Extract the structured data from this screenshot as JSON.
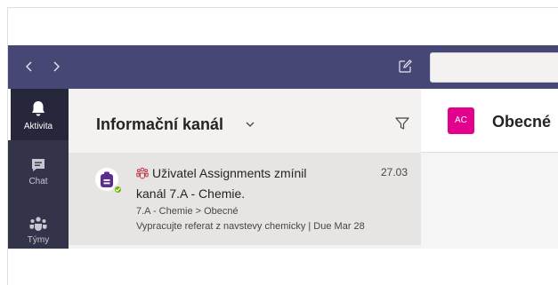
{
  "window": {
    "back_icon": "chevron-left-icon",
    "forward_icon": "chevron-right-icon",
    "compose_icon": "compose-icon",
    "topbar_color": "#464775"
  },
  "rail": {
    "items": [
      {
        "label": "Aktivita",
        "icon": "bell-icon",
        "active": true
      },
      {
        "label": "Chat",
        "icon": "chat-icon",
        "active": false
      },
      {
        "label": "Týmy",
        "icon": "teams-icon",
        "active": false
      }
    ]
  },
  "feed": {
    "title": "Informační kanál",
    "items": [
      {
        "line1": "Uživatel Assignments zmínil",
        "line2": "kanál 7.A - Chemie.",
        "time": "27.03",
        "path": "7.A - Chemie > Obecné",
        "description": "Vypracujte referat z navstevy chemicky | Due Mar 28",
        "status": "available"
      }
    ]
  },
  "channel": {
    "avatar_initials": "AC",
    "name": "Obecné",
    "avatar_color": "#e3008c"
  }
}
